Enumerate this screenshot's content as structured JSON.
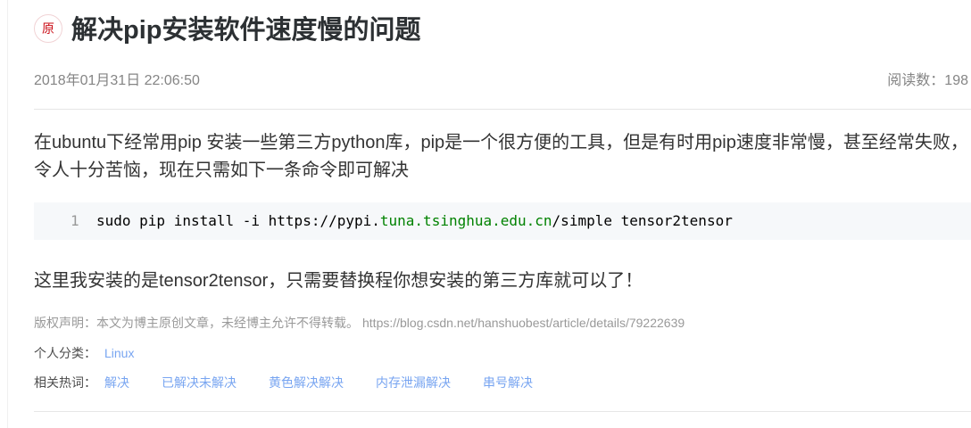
{
  "article": {
    "badge": "原",
    "title": "解决pip安装软件速度慢的问题",
    "date": "2018年01月31日 22:06:50",
    "read_count": {
      "label": "阅读数：",
      "value": "198"
    },
    "paragraph1": [
      "在ubuntu下经常用pip 安装一些第三方python库，pip是一个很方便的工具，但是有时用pip速度非常慢，甚至经常失败，",
      "令人十分苦恼，现在只需如下一条命令即可解决"
    ],
    "code": {
      "line_number": "1",
      "segments": [
        "sudo pip install -i https://pypi.",
        "tuna.tsinghua.edu.cn",
        "/simple tensor2tensor"
      ]
    },
    "paragraph2": "这里我安装的是tensor2tensor，只需要替换程你想安装的第三方库就可以了！",
    "copyright": {
      "text": "版权声明：本文为博主原创文章，未经博主允许不得转载。",
      "url": "https://blog.csdn.net/hanshuobest/article/details/79222639"
    },
    "category": {
      "label": "个人分类：",
      "items": [
        "Linux"
      ]
    },
    "hot_words": {
      "label": "相关热词：",
      "items": [
        "解决",
        "已解决未解决",
        "黄色解决解决",
        "内存泄漏解决",
        "串号解决"
      ]
    }
  },
  "colors": {
    "badge": "#ca0c16",
    "link": "#78a5f1",
    "code_highlight": "#008200",
    "text": "#333333",
    "muted": "#999999"
  }
}
